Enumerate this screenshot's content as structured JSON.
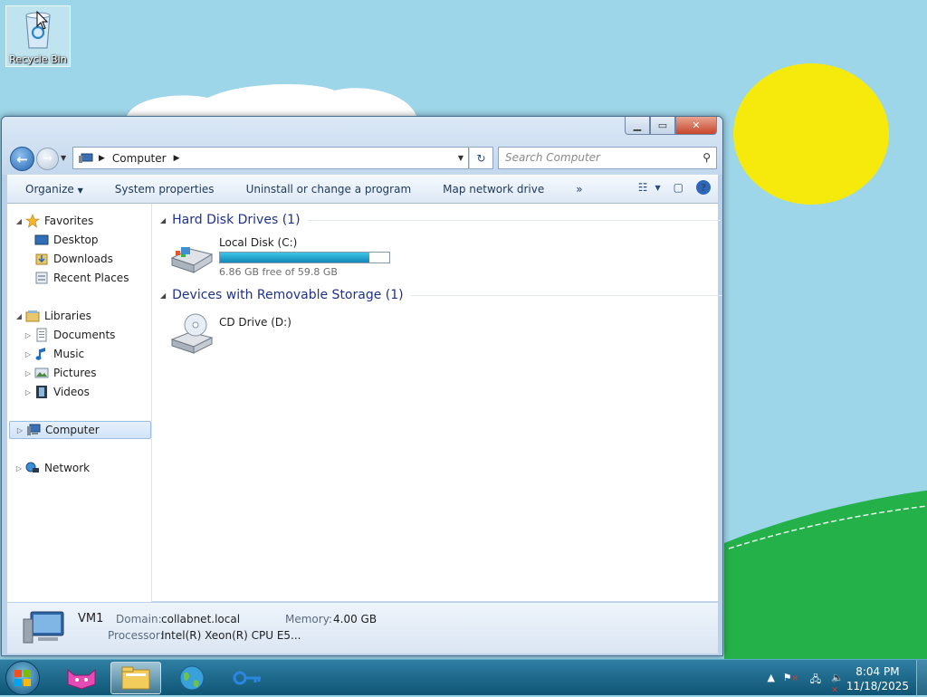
{
  "desktop": {
    "recycle_bin_label": "Recycle Bin"
  },
  "window": {
    "address": {
      "crumbs": [
        "Computer"
      ]
    },
    "search_placeholder": "Search Computer",
    "toolbar": {
      "organize": "Organize",
      "system_properties": "System properties",
      "uninstall": "Uninstall or change a program",
      "map_drive": "Map network drive",
      "more": "»"
    },
    "nav": {
      "favorites": "Favorites",
      "desktop": "Desktop",
      "downloads": "Downloads",
      "recent_places": "Recent Places",
      "libraries": "Libraries",
      "documents": "Documents",
      "music": "Music",
      "pictures": "Pictures",
      "videos": "Videos",
      "computer": "Computer",
      "network": "Network"
    },
    "content": {
      "hard_disk_group": "Hard Disk Drives (1)",
      "local_disk_name": "Local Disk (C:)",
      "local_disk_free": "6.86 GB free of 59.8 GB",
      "local_disk_used_fraction": 0.885,
      "removable_group": "Devices with Removable Storage (1)",
      "cd_drive_name": "CD Drive (D:)"
    },
    "details": {
      "computer_name": "VM1",
      "domain_label": "Domain:",
      "domain_value": "collabnet.local",
      "memory_label": "Memory:",
      "memory_value": "4.00 GB",
      "processor_label": "Processor:",
      "processor_value": "Intel(R) Xeon(R) CPU E5..."
    }
  },
  "taskbar": {
    "clock_time": "8:04 PM",
    "clock_date": "11/18/2025"
  },
  "colors": {
    "sky": "#9dd6e8",
    "sun": "#f6ea0c",
    "grass": "#24b14a",
    "taskbar": "#1c6a8c",
    "group_header": "#1e3287"
  }
}
